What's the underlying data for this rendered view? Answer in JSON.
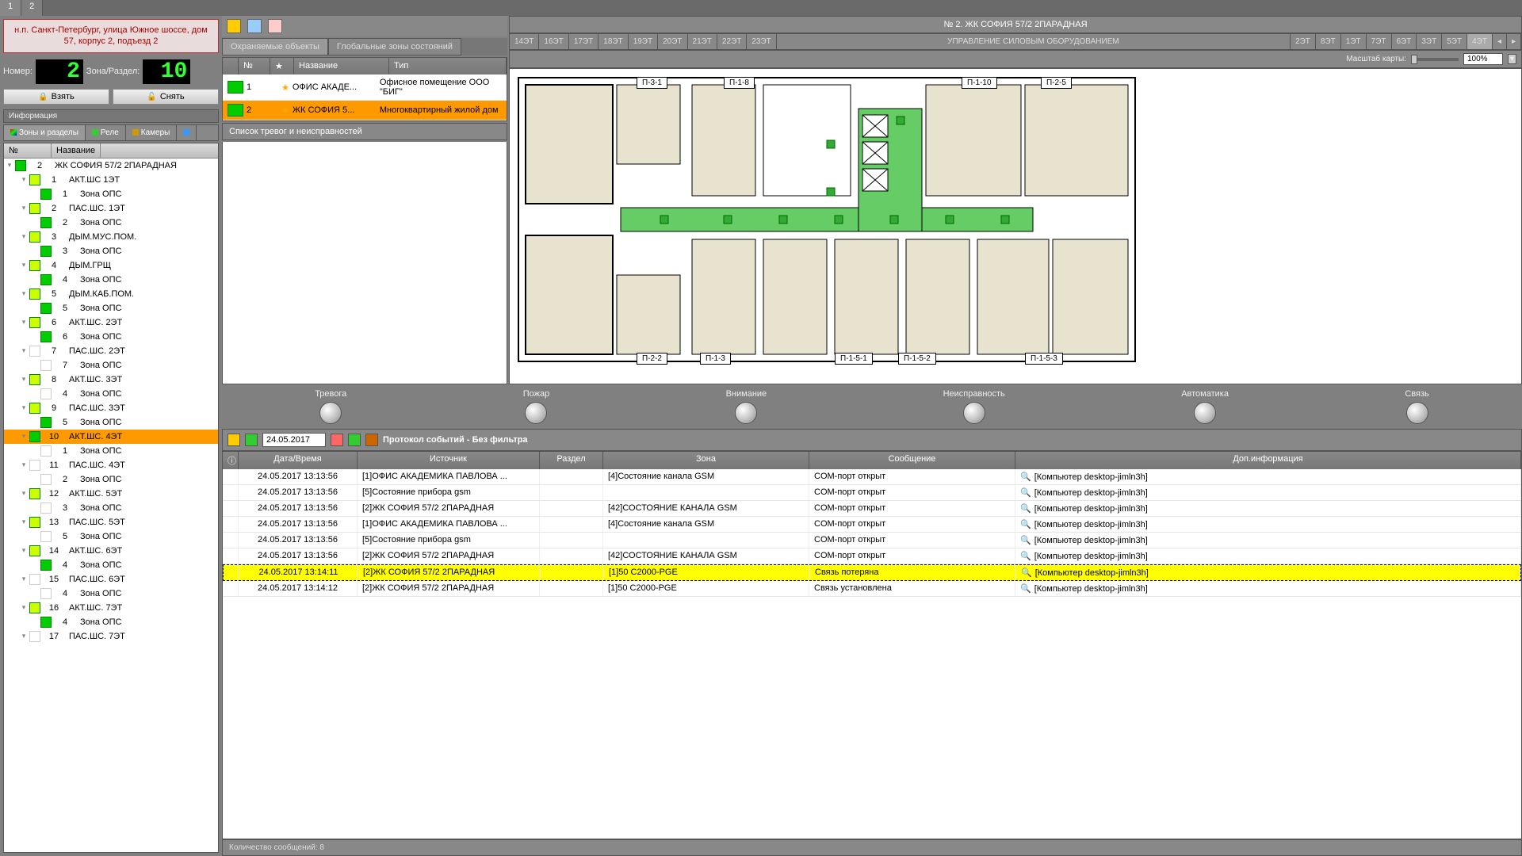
{
  "window": {
    "tab1": "1",
    "tab2": "2"
  },
  "address": "н.п. Санкт-Петербург, улица Южное шоссе, дом 57, корпус 2, подъезд 2",
  "numbers": {
    "num_label": "Номер:",
    "num_val": "2",
    "sec_label": "Зона/Раздел:",
    "sec_val": "10"
  },
  "arm": {
    "take": "Взять",
    "drop": "Снять"
  },
  "info_header": "Информация",
  "info_tabs": {
    "zones": "Зоны и разделы",
    "relay": "Реле",
    "cameras": "Камеры"
  },
  "tree": {
    "cols": {
      "n": "№",
      "name": "Название"
    },
    "root": {
      "num": "2",
      "name": "ЖК СОФИЯ 57/2 2ПАРАДНАЯ"
    },
    "items": [
      {
        "num": "1",
        "name": "АКТ.ШС 1ЭТ",
        "lvl": 1,
        "c": "#cf0"
      },
      {
        "num": "1",
        "name": "Зона ОПС",
        "lvl": 2,
        "c": "#0c0"
      },
      {
        "num": "2",
        "name": "ПАС.ШС. 1ЭТ",
        "lvl": 1,
        "c": "#cf0"
      },
      {
        "num": "2",
        "name": "Зона ОПС",
        "lvl": 2,
        "c": "#0c0"
      },
      {
        "num": "3",
        "name": "ДЫМ.МУС.ПОМ.",
        "lvl": 1,
        "c": "#cf0"
      },
      {
        "num": "3",
        "name": "Зона ОПС",
        "lvl": 2,
        "c": "#0c0"
      },
      {
        "num": "4",
        "name": "ДЫМ.ГРЩ",
        "lvl": 1,
        "c": "#cf0"
      },
      {
        "num": "4",
        "name": "Зона ОПС",
        "lvl": 2,
        "c": "#0c0"
      },
      {
        "num": "5",
        "name": "ДЫМ.КАБ.ПОМ.",
        "lvl": 1,
        "c": "#cf0"
      },
      {
        "num": "5",
        "name": "Зона ОПС",
        "lvl": 2,
        "c": "#0c0"
      },
      {
        "num": "6",
        "name": "АКТ.ШС. 2ЭТ",
        "lvl": 1,
        "c": "#cf0"
      },
      {
        "num": "6",
        "name": "Зона ОПС",
        "lvl": 2,
        "c": "#0c0"
      },
      {
        "num": "7",
        "name": "ПАС.ШС. 2ЭТ",
        "lvl": 1,
        "c": ""
      },
      {
        "num": "7",
        "name": "Зона ОПС",
        "lvl": 2,
        "c": ""
      },
      {
        "num": "8",
        "name": "АКТ.ШС. 3ЭТ",
        "lvl": 1,
        "c": "#cf0"
      },
      {
        "num": "4",
        "name": "Зона ОПС",
        "lvl": 2,
        "c": ""
      },
      {
        "num": "9",
        "name": "ПАС.ШС. 3ЭТ",
        "lvl": 1,
        "c": "#cf0"
      },
      {
        "num": "5",
        "name": "Зона ОПС",
        "lvl": 2,
        "c": "#0c0"
      },
      {
        "num": "10",
        "name": "АКТ.ШС. 4ЭТ",
        "lvl": 1,
        "c": "#0c0",
        "sel": true
      },
      {
        "num": "1",
        "name": "Зона ОПС",
        "lvl": 2,
        "c": ""
      },
      {
        "num": "11",
        "name": "ПАС.ШС. 4ЭТ",
        "lvl": 1,
        "c": ""
      },
      {
        "num": "2",
        "name": "Зона ОПС",
        "lvl": 2,
        "c": ""
      },
      {
        "num": "12",
        "name": "АКТ.ШС. 5ЭТ",
        "lvl": 1,
        "c": "#cf0"
      },
      {
        "num": "3",
        "name": "Зона ОПС",
        "lvl": 2,
        "c": ""
      },
      {
        "num": "13",
        "name": "ПАС.ШС. 5ЭТ",
        "lvl": 1,
        "c": "#cf0"
      },
      {
        "num": "5",
        "name": "Зона ОПС",
        "lvl": 2,
        "c": ""
      },
      {
        "num": "14",
        "name": "АКТ.ШС. 6ЭТ",
        "lvl": 1,
        "c": "#cf0"
      },
      {
        "num": "4",
        "name": "Зона ОПС",
        "lvl": 2,
        "c": "#0c0"
      },
      {
        "num": "15",
        "name": "ПАС.ШС. 6ЭТ",
        "lvl": 1,
        "c": ""
      },
      {
        "num": "4",
        "name": "Зона ОПС",
        "lvl": 2,
        "c": ""
      },
      {
        "num": "16",
        "name": "АКТ.ШС. 7ЭТ",
        "lvl": 1,
        "c": "#cf0"
      },
      {
        "num": "4",
        "name": "Зона ОПС",
        "lvl": 2,
        "c": "#0c0"
      },
      {
        "num": "17",
        "name": "ПАС.ШС. 7ЭТ",
        "lvl": 1,
        "c": ""
      }
    ]
  },
  "sub_tabs": {
    "protected": "Охраняемые объекты",
    "global": "Глобальные зоны состояний"
  },
  "objects": {
    "cols": {
      "n": "№",
      "name": "Название",
      "type": "Тип"
    },
    "rows": [
      {
        "num": "1",
        "name": "ОФИС АКАДЕ...",
        "type": "Офисное помещение ООО \"БИГ\""
      },
      {
        "num": "2",
        "name": "ЖК СОФИЯ 5...",
        "type": "Многоквартирный жилой дом",
        "sel": true
      }
    ]
  },
  "alarms_header": "Список тревог и неисправностей",
  "map": {
    "title": "№ 2. ЖК СОФИЯ 57/2 2ПАРАДНАЯ",
    "floors": [
      "14ЭТ",
      "16ЭТ",
      "17ЭТ",
      "18ЭТ",
      "19ЭТ",
      "20ЭТ",
      "21ЭТ",
      "22ЭТ",
      "23ЭТ"
    ],
    "floors_mgmt": "УПРАВЛЕНИЕ СИЛОВЫМ ОБОРУДОВАНИЕМ",
    "floors2": [
      "2ЭТ",
      "8ЭТ",
      "1ЭТ",
      "7ЭТ",
      "6ЭТ",
      "3ЭТ",
      "5ЭТ",
      "4ЭТ"
    ],
    "scale_label": "Масштаб карты:",
    "scale_val": "100%",
    "labels": [
      "П-3-1",
      "П-1-8",
      "П-1-10",
      "П-2-5",
      "П-2-2",
      "П-1-3",
      "П-1-5-1",
      "П-1-5-2",
      "П-1-5-3"
    ]
  },
  "lamps": [
    "Тревога",
    "Пожар",
    "Внимание",
    "Неисправность",
    "Автоматика",
    "Связь"
  ],
  "proto": {
    "date": "24.05.2017",
    "label": "Протокол событий - Без фильтра",
    "cols": {
      "dt": "Дата/Время",
      "src": "Источник",
      "sec": "Раздел",
      "zone": "Зона",
      "msg": "Сообщение",
      "extra": "Доп.информация"
    },
    "rows": [
      {
        "dt": "24.05.2017 13:13:56",
        "src": "[1]ОФИС АКАДЕМИКА ПАВЛОВА ...",
        "zone": "[4]Состояние канала GSM",
        "msg": "COM-порт открыт",
        "extra": "[Компьютер desktop-jimln3h]"
      },
      {
        "dt": "24.05.2017 13:13:56",
        "src": "[5]Состояние прибора gsm",
        "zone": "",
        "msg": "COM-порт открыт",
        "extra": "[Компьютер desktop-jimln3h]"
      },
      {
        "dt": "24.05.2017 13:13:56",
        "src": "[2]ЖК СОФИЯ 57/2 2ПАРАДНАЯ",
        "zone": "[42]СОСТОЯНИЕ КАНАЛА GSM",
        "msg": "COM-порт открыт",
        "extra": "[Компьютер desktop-jimln3h]"
      },
      {
        "dt": "24.05.2017 13:13:56",
        "src": "[1]ОФИС АКАДЕМИКА ПАВЛОВА ...",
        "zone": "[4]Состояние канала GSM",
        "msg": "COM-порт открыт",
        "extra": "[Компьютер desktop-jimln3h]"
      },
      {
        "dt": "24.05.2017 13:13:56",
        "src": "[5]Состояние прибора gsm",
        "zone": "",
        "msg": "COM-порт открыт",
        "extra": "[Компьютер desktop-jimln3h]"
      },
      {
        "dt": "24.05.2017 13:13:56",
        "src": "[2]ЖК СОФИЯ 57/2 2ПАРАДНАЯ",
        "zone": "[42]СОСТОЯНИЕ КАНАЛА GSM",
        "msg": "COM-порт открыт",
        "extra": "[Компьютер desktop-jimln3h]"
      },
      {
        "dt": "24.05.2017 13:14:11",
        "src": "[2]ЖК СОФИЯ 57/2 2ПАРАДНАЯ",
        "zone": "[1]50 С2000-PGE",
        "msg": "Связь потеряна",
        "extra": "[Компьютер desktop-jimln3h]",
        "hl": true
      },
      {
        "dt": "24.05.2017 13:14:12",
        "src": "[2]ЖК СОФИЯ 57/2 2ПАРАДНАЯ",
        "zone": "[1]50 С2000-PGE",
        "msg": "Связь установлена",
        "extra": "[Компьютер desktop-jimln3h]"
      }
    ]
  },
  "status": "Количество сообщений: 8"
}
